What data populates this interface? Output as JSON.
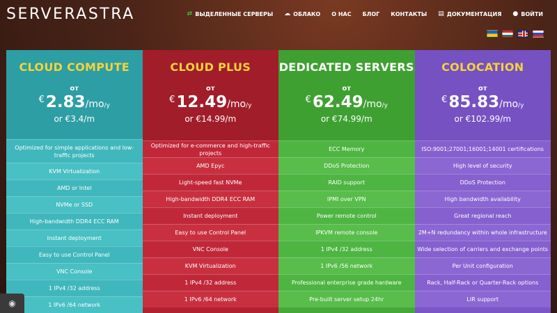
{
  "logo": {
    "text_a": "SERVER",
    "text_b": "ASTRA"
  },
  "nav": [
    {
      "label": "ВЫДЕЛЕННЫЕ СЕРВЕРЫ",
      "icon": "server-icon"
    },
    {
      "label": "ОБЛАКО",
      "icon": "cloud-icon"
    },
    {
      "label": "О НАС",
      "icon": ""
    },
    {
      "label": "БЛОГ",
      "icon": ""
    },
    {
      "label": "КОНТАКТЫ",
      "icon": ""
    },
    {
      "label": "ДОКУМЕНТАЦИЯ",
      "icon": "document-icon"
    },
    {
      "label": "ВОЙТИ",
      "icon": "user-icon"
    }
  ],
  "flags": [
    "ua",
    "hu",
    "gb",
    "ru"
  ],
  "plans": [
    {
      "title": "CLOUD COMPUTE",
      "from": "от",
      "currency": "€",
      "amount": "2.83",
      "per": "/mo",
      "per_sub": "/y",
      "alt": "or €3.4/m",
      "features": [
        "Optimized for simple applications and low-traffic projects",
        "KVM Virtualization",
        "AMD or Intel",
        "NVMe or SSD",
        "High-bandwidth DDR4 ECC RAM",
        "Instant deployment",
        "Easy to use Control Panel",
        "VNC Console",
        "1 IPv4 /32 address",
        "1 IPv6 /64 network"
      ]
    },
    {
      "title": "CLOUD PLUS",
      "from": "от",
      "currency": "€",
      "amount": "12.49",
      "per": "/mo",
      "per_sub": "/y",
      "alt": "or €14.99/m",
      "features": [
        "Optimized for e-commerce and high-traffic projects",
        "AMD Epyc",
        "Light-speed fast NVMe",
        "High-bandwidth DDR4 ECC RAM",
        "Instant deployment",
        "Easy to use Control Panel",
        "VNC Console",
        "KVM Virtualization",
        "1 IPv4 /32 address",
        "1 IPv6 /64 network"
      ]
    },
    {
      "title": "DEDICATED SERVERS",
      "from": "от",
      "currency": "€",
      "amount": "62.49",
      "per": "/mo",
      "per_sub": "/y",
      "alt": "or €74.99/m",
      "features": [
        "ECC Memory",
        "DDoS Protection",
        "RAID support",
        "IPMI over VPN",
        "Power remote control",
        "IPKVM remote console",
        "1 IPv4 /32 address",
        "1 IPv6 /56 network",
        "Professional enterprise grade hardware",
        "Pre-built server setup 24hr"
      ]
    },
    {
      "title": "COLOCATION",
      "from": "от",
      "currency": "€",
      "amount": "85.83",
      "per": "/mo",
      "per_sub": "/y",
      "alt": "or €102.99/m",
      "features": [
        "ISO:9001;27001;16001;14001 certifications",
        "High level of security",
        "DDoS Protection",
        "High bandwidth availability",
        "Great regional reach",
        "2M+N redundancy within whole infrastructure",
        "Wide selection of carriers and exchange points",
        "Per Unit configuration",
        "Rack, Half-Rack or Quarter-Rack options",
        "LIR support"
      ]
    }
  ]
}
